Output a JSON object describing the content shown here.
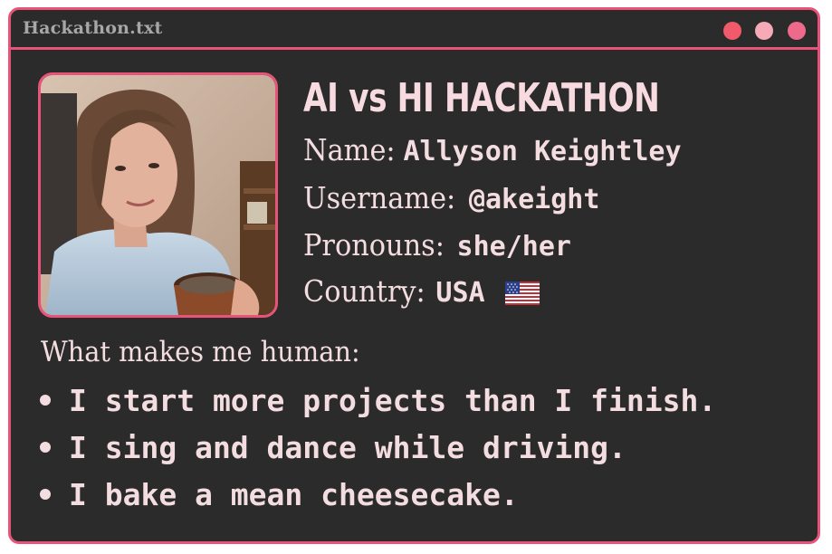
{
  "window": {
    "title": "Hackathon.txt",
    "accent_color": "#e8537a",
    "controls": [
      "close-dot",
      "minimize-dot",
      "maximize-dot"
    ]
  },
  "profile": {
    "heading": "AI vs HI HACKATHON",
    "name_label": "Name:",
    "name_value": "Allyson Keightley",
    "username_label": "Username:",
    "username_value": "@akeight",
    "pronouns_label": "Pronouns:",
    "pronouns_value": "she/her",
    "country_label": "Country:",
    "country_value": "USA",
    "country_flag": "us-flag-icon"
  },
  "human": {
    "heading": "What makes me human:",
    "items": [
      "I start more projects than I finish.",
      "I sing and dance while driving.",
      "I bake a mean cheesecake."
    ]
  }
}
